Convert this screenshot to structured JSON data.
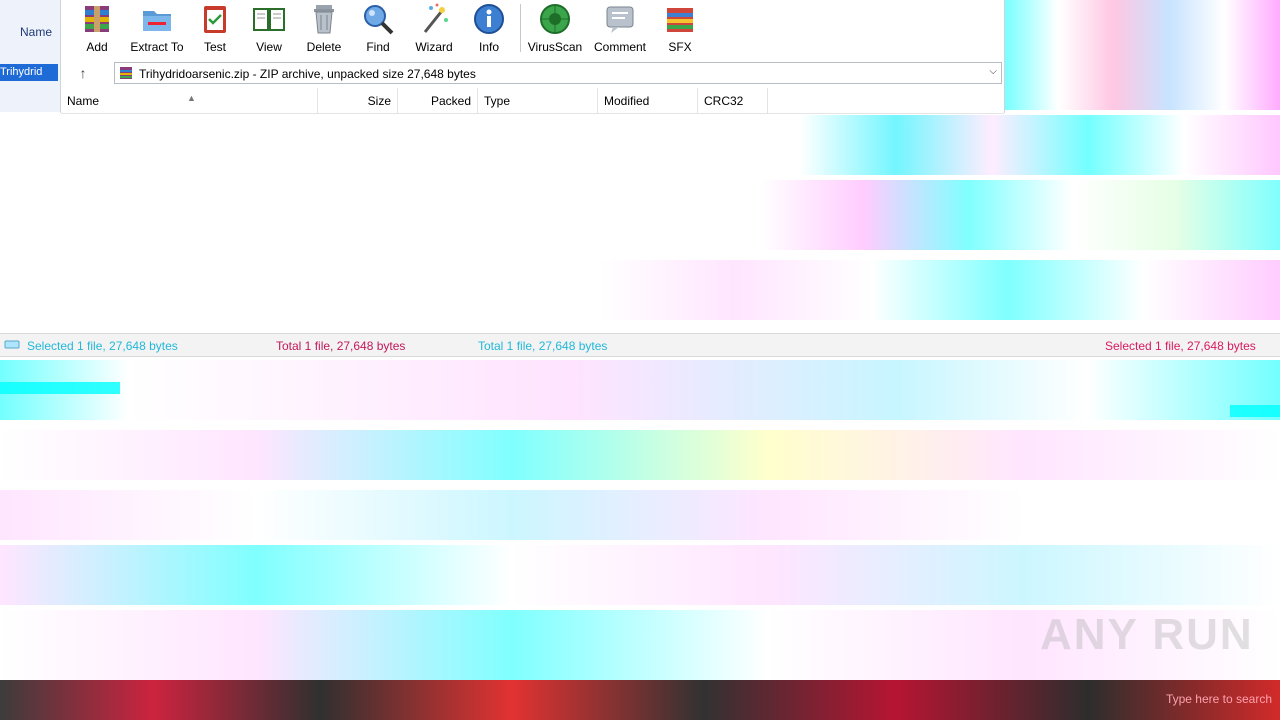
{
  "left_panel": {
    "name_label": "Name",
    "selected_item": "Trihydrid"
  },
  "toolbar": {
    "buttons": [
      {
        "label": "Add"
      },
      {
        "label": "Extract To"
      },
      {
        "label": "Test"
      },
      {
        "label": "View"
      },
      {
        "label": "Delete"
      },
      {
        "label": "Find"
      },
      {
        "label": "Wizard"
      },
      {
        "label": "Info"
      },
      {
        "label": "VirusScan"
      },
      {
        "label": "Comment"
      },
      {
        "label": "SFX"
      }
    ]
  },
  "address": {
    "up_glyph": "↑",
    "path": "Trihydridoarsenic.zip - ZIP archive, unpacked size 27,648 bytes"
  },
  "columns": [
    {
      "label": "Name"
    },
    {
      "label": "Size"
    },
    {
      "label": "Packed"
    },
    {
      "label": "Type"
    },
    {
      "label": "Modified"
    },
    {
      "label": "CRC32"
    }
  ],
  "status": {
    "selected": "Selected 1 file, 27,648 bytes",
    "total": "Total 1 file, 27,648 bytes",
    "total_alt": "Total 1 file, 27,648 bytes",
    "selected_right": "Selected 1 file, 27,648 bytes"
  },
  "taskbar": {
    "search_hint": "Type here to search"
  },
  "watermark": "ANY RUN"
}
